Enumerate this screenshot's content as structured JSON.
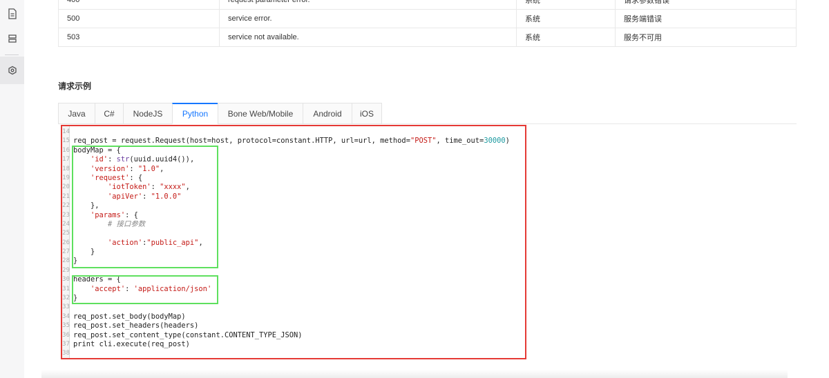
{
  "sidebar": {
    "items": [
      {
        "icon": "document-icon",
        "active": false
      },
      {
        "icon": "layers-icon",
        "active": false
      },
      {
        "icon": "settings-hex-icon",
        "active": true
      }
    ]
  },
  "error_table": {
    "rows": [
      [
        "400",
        "request parameter error.",
        "系统",
        "请求参数错误"
      ],
      [
        "500",
        "service error.",
        "系统",
        "服务端错误"
      ],
      [
        "503",
        "service not available.",
        "系统",
        "服务不可用"
      ]
    ]
  },
  "section_title": "请求示例",
  "tabs": {
    "items": [
      "Java",
      "C#",
      "NodeJS",
      "Python",
      "Bone Web/Mobile",
      "Android",
      "iOS"
    ],
    "active": "Python"
  },
  "code": {
    "lines": [
      {
        "n": "14",
        "t": ""
      },
      {
        "n": "15",
        "t": "req_post = request.Request(host=host, protocol=constant.HTTP, url=url, method=\"POST\", time_out=30000)"
      },
      {
        "n": "16",
        "t": "bodyMap = {"
      },
      {
        "n": "17",
        "t": "    'id': str(uuid.uuid4()),"
      },
      {
        "n": "18",
        "t": "    'version': \"1.0\","
      },
      {
        "n": "19",
        "t": "    'request': {"
      },
      {
        "n": "20",
        "t": "        'iotToken': \"xxxx\","
      },
      {
        "n": "21",
        "t": "        'apiVer': \"1.0.0\""
      },
      {
        "n": "22",
        "t": "    },"
      },
      {
        "n": "23",
        "t": "    'params': {"
      },
      {
        "n": "24",
        "t": "        # 接口参数"
      },
      {
        "n": "25",
        "t": ""
      },
      {
        "n": "26",
        "t": "        'action':\"public_api\","
      },
      {
        "n": "27",
        "t": "    }"
      },
      {
        "n": "28",
        "t": "}"
      },
      {
        "n": "29",
        "t": ""
      },
      {
        "n": "30",
        "t": "headers = {"
      },
      {
        "n": "31",
        "t": "    'accept': 'application/json'"
      },
      {
        "n": "32",
        "t": "}"
      },
      {
        "n": "33",
        "t": ""
      },
      {
        "n": "34",
        "t": "req_post.set_body(bodyMap)"
      },
      {
        "n": "35",
        "t": "req_post.set_headers(headers)"
      },
      {
        "n": "36",
        "t": "req_post.set_content_type(constant.CONTENT_TYPE_JSON)"
      },
      {
        "n": "37",
        "t": "print cli.execute(req_post)"
      },
      {
        "n": "38",
        "t": ""
      }
    ]
  },
  "colors": {
    "outer_highlight": "#e53935",
    "inner_highlight": "#5ee05e",
    "active_tab": "#1677ff"
  }
}
